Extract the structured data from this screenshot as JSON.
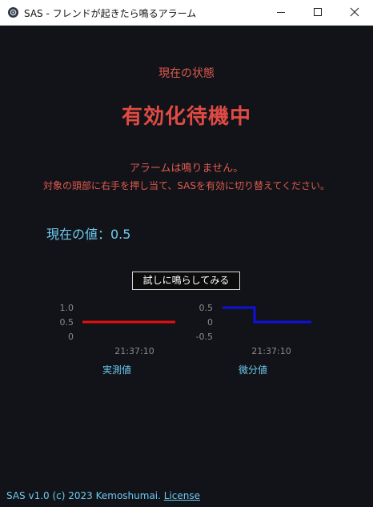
{
  "window": {
    "title": "SAS - フレンドが起きたら鳴るアラーム",
    "icon": "gear-icon",
    "controls": [
      "minimize-icon",
      "maximize-icon",
      "close-icon"
    ]
  },
  "status": {
    "heading": "現在の状態",
    "value": "有効化待機中",
    "alarm_message": "アラームは鳴りません。",
    "instruction": "対象の頭部に右手を押し当て、SASを有効に切り替えてください。",
    "current_value_label": "現在の値：0.5"
  },
  "test_button": {
    "label": "試しに鳴らしてみる"
  },
  "charts": [
    {
      "caption": "実測値",
      "time_label": "21:37:10",
      "color": "#e81010",
      "chart_data": {
        "type": "line",
        "yticks": [
          "1.0",
          "0.5",
          "0"
        ],
        "ylim": [
          0,
          1.0
        ],
        "x": [
          "21:37:10"
        ],
        "series": [
          {
            "values": [
              0.5,
              0.5
            ]
          }
        ]
      }
    },
    {
      "caption": "微分値",
      "time_label": "21:37:10",
      "color": "#1010e0",
      "chart_data": {
        "type": "line",
        "yticks": [
          "0.5",
          "0",
          "-0.5"
        ],
        "ylim": [
          -0.5,
          0.5
        ],
        "x": [
          "21:37:10"
        ],
        "series": [
          {
            "values": [
              0.5,
              0.5,
              0,
              0
            ]
          }
        ]
      }
    }
  ],
  "footer": {
    "text": "SAS v1.0 (c) 2023 Kemoshumai. ",
    "license_label": "License"
  },
  "colors": {
    "background": "#111318",
    "status_red": "#e04a44",
    "accent_blue": "#6ec9ee"
  }
}
